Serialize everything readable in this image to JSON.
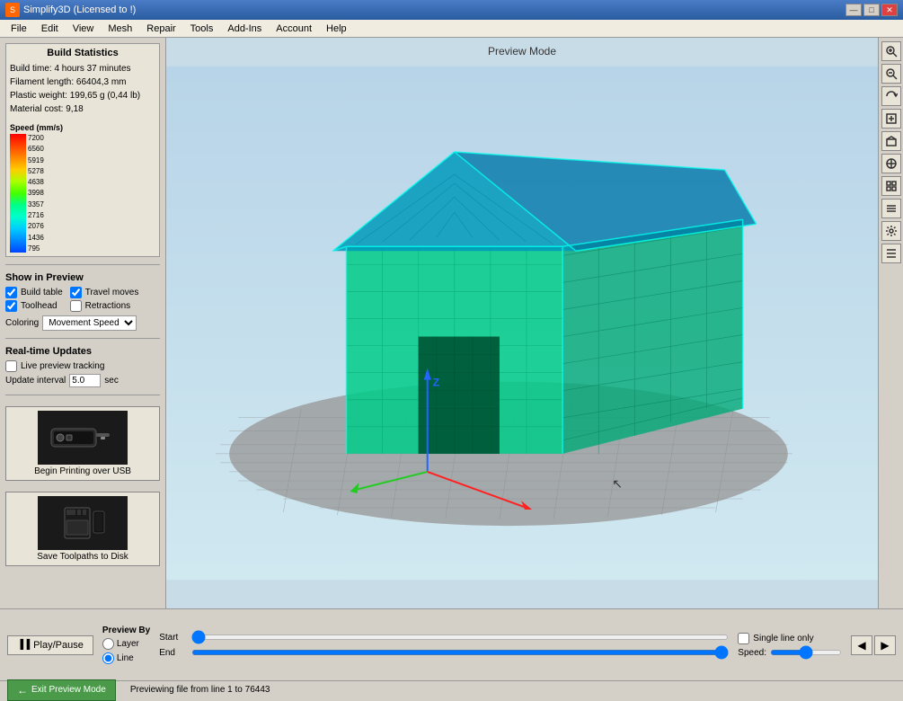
{
  "titleBar": {
    "title": "Simplify3D (Licensed to !)",
    "minBtn": "—",
    "maxBtn": "□",
    "closeBtn": "✕"
  },
  "menuBar": {
    "items": [
      "File",
      "Edit",
      "View",
      "Mesh",
      "Repair",
      "Tools",
      "Add-Ins",
      "Account",
      "Help"
    ]
  },
  "leftPanel": {
    "buildStats": {
      "title": "Build Statistics",
      "buildTime": "Build time: 4 hours 37 minutes",
      "filamentLength": "Filament length: 66404,3 mm",
      "plasticWeight": "Plastic weight: 199,65 g (0,44 lb)",
      "materialCost": "Material cost: 9,18"
    },
    "speedLegend": {
      "title": "Speed (mm/s)",
      "values": [
        "7200",
        "6560",
        "5919",
        "5278",
        "4638",
        "3998",
        "3357",
        "2716",
        "2076",
        "1436",
        "795"
      ],
      "colors": [
        "#ff0000",
        "#ff4400",
        "#ff8800",
        "#ffcc00",
        "#aaff00",
        "#44ff00",
        "#00ff88",
        "#00ffcc",
        "#00ccff",
        "#0088ff",
        "#0044ff"
      ]
    },
    "showInPreview": {
      "title": "Show in Preview",
      "checkboxes": [
        {
          "label": "Build table",
          "checked": true
        },
        {
          "label": "Travel moves",
          "checked": true
        },
        {
          "label": "Toolhead",
          "checked": true
        },
        {
          "label": "Retractions",
          "checked": false
        }
      ],
      "coloringLabel": "Coloring",
      "coloringValue": "Movement Speed"
    },
    "realtimeUpdates": {
      "title": "Real-time Updates",
      "livePreviewLabel": "Live preview tracking",
      "livePreviewChecked": false,
      "updateIntervalLabel": "Update interval",
      "updateIntervalValue": "5.0",
      "secLabel": "sec"
    },
    "usbBtn": {
      "label": "Begin Printing over USB"
    },
    "sdBtn": {
      "label": "Save Toolpaths to Disk"
    }
  },
  "viewport": {
    "previewModeLabel": "Preview Mode"
  },
  "rightToolbar": {
    "buttons": [
      "⊕",
      "⊖",
      "↻",
      "⊡",
      "◈",
      "◉",
      "⊞",
      "⊟",
      "⚙",
      "≡"
    ]
  },
  "bottomBar": {
    "playPauseLabel": "▐▐ Play/Pause",
    "previewByLabel": "Preview By",
    "layerLabel": "Layer",
    "lineLabel": "Line",
    "lineSelected": true,
    "layerSelected": false,
    "startLabel": "Start",
    "endLabel": "End",
    "speedLabel": "Speed:",
    "singleLineLabel": "Single line only",
    "singleLineChecked": false,
    "prevBtn": "◀",
    "nextBtn": "▶"
  },
  "statusBar": {
    "text": "Previewing file from line 1 to 76443",
    "exitPreviewLabel": "Exit Preview Mode"
  }
}
